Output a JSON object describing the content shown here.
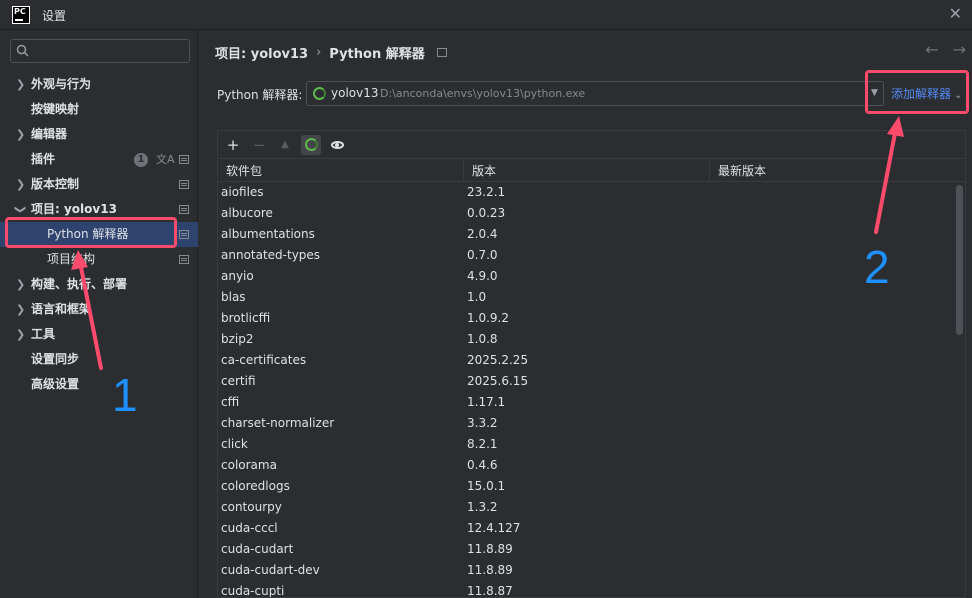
{
  "window": {
    "title": "设置",
    "logo_text": "PC"
  },
  "search": {
    "placeholder": ""
  },
  "sidebar": {
    "items": [
      {
        "label": "外观与行为",
        "expandable": true
      },
      {
        "label": "按键映射",
        "expandable": false
      },
      {
        "label": "编辑器",
        "expandable": true
      },
      {
        "label": "插件",
        "expandable": false,
        "badge": "1"
      },
      {
        "label": "版本控制",
        "expandable": true
      },
      {
        "label": "项目: yolov13",
        "expandable": true,
        "expanded": true
      },
      {
        "label": "Python 解释器",
        "child": true,
        "selected": true
      },
      {
        "label": "项目结构",
        "child": true
      },
      {
        "label": "构建、执行、部署",
        "expandable": true
      },
      {
        "label": "语言和框架",
        "expandable": true
      },
      {
        "label": "工具",
        "expandable": true
      },
      {
        "label": "设置同步",
        "expandable": false
      },
      {
        "label": "高级设置",
        "expandable": false
      }
    ]
  },
  "breadcrumb": {
    "project": "项目: yolov13",
    "separator": "›",
    "page": "Python 解释器"
  },
  "interpreter": {
    "label": "Python 解释器:",
    "name": "yolov13",
    "path": "D:\\anconda\\envs\\yolov13\\python.exe",
    "add_label": "添加解释器"
  },
  "toolbar": {
    "add": "+",
    "remove": "−",
    "up": "▲"
  },
  "table": {
    "headers": [
      "软件包",
      "版本",
      "最新版本"
    ],
    "rows": [
      [
        "aiofiles",
        "23.2.1",
        ""
      ],
      [
        "albucore",
        "0.0.23",
        ""
      ],
      [
        "albumentations",
        "2.0.4",
        ""
      ],
      [
        "annotated-types",
        "0.7.0",
        ""
      ],
      [
        "anyio",
        "4.9.0",
        ""
      ],
      [
        "blas",
        "1.0",
        ""
      ],
      [
        "brotlicffi",
        "1.0.9.2",
        ""
      ],
      [
        "bzip2",
        "1.0.8",
        ""
      ],
      [
        "ca-certificates",
        "2025.2.25",
        ""
      ],
      [
        "certifi",
        "2025.6.15",
        ""
      ],
      [
        "cffi",
        "1.17.1",
        ""
      ],
      [
        "charset-normalizer",
        "3.3.2",
        ""
      ],
      [
        "click",
        "8.2.1",
        ""
      ],
      [
        "colorama",
        "0.4.6",
        ""
      ],
      [
        "coloredlogs",
        "15.0.1",
        ""
      ],
      [
        "contourpy",
        "1.3.2",
        ""
      ],
      [
        "cuda-cccl",
        "12.4.127",
        ""
      ],
      [
        "cuda-cudart",
        "11.8.89",
        ""
      ],
      [
        "cuda-cudart-dev",
        "11.8.89",
        ""
      ],
      [
        "cuda-cupti",
        "11.8.87",
        ""
      ]
    ]
  },
  "annotations": {
    "one": "1",
    "two": "2"
  },
  "colors": {
    "accent": "#548af7",
    "selection": "#2e436e",
    "annotation_box": "#ff4b6b",
    "annotation_number": "#1e90ff",
    "ok_ring": "#5fb84c"
  }
}
